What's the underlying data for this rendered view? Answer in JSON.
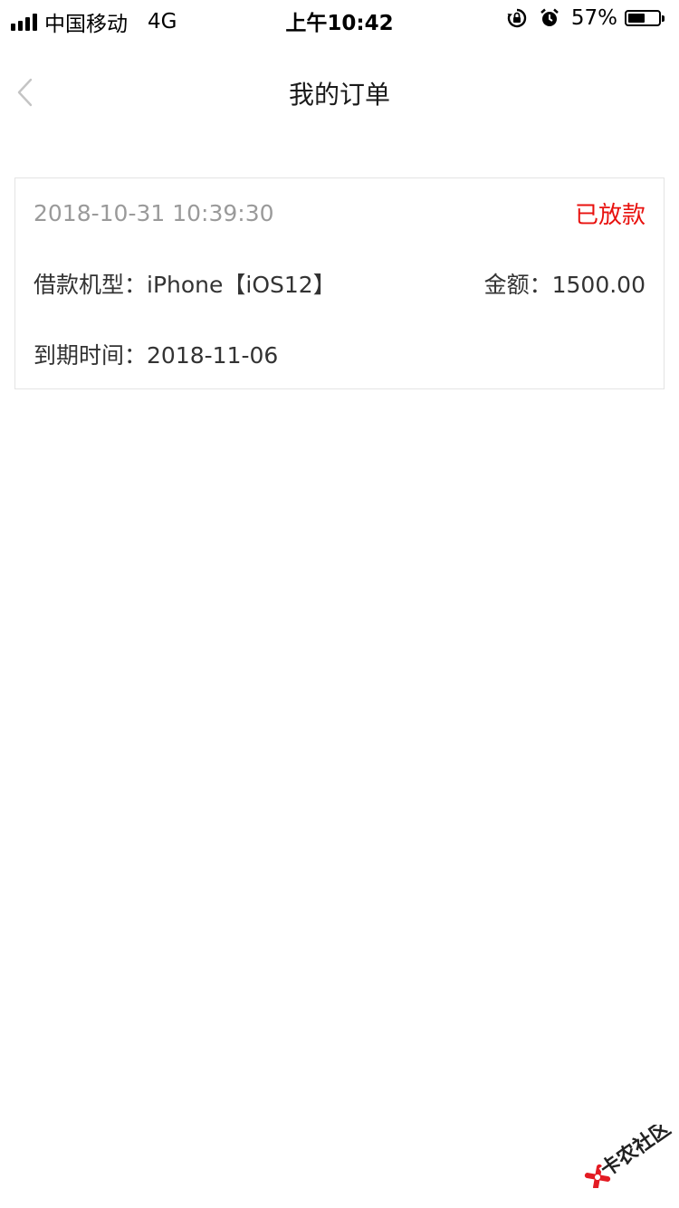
{
  "status_bar": {
    "carrier": "中国移动",
    "network": "4G",
    "time": "上午10:42",
    "battery_percent": "57%",
    "battery_level": 0.57,
    "icons": [
      "signal-icon",
      "rotation-lock-icon",
      "alarm-icon",
      "battery-icon"
    ]
  },
  "nav": {
    "title": "我的订单",
    "back_icon": "chevron-left-icon"
  },
  "order": {
    "datetime": "2018-10-31 10:39:30",
    "status": "已放款",
    "model_label": "借款机型：",
    "model_value": "iPhone【iOS12】",
    "amount_label": "金额：",
    "amount_value": "1500.00",
    "due_label": "到期时间：",
    "due_value": "2018-11-06"
  },
  "watermark": {
    "text": "卡农社区"
  },
  "colors": {
    "status_red": "#e8110e",
    "muted_gray": "#9a9a9a",
    "border": "#e4e4e4",
    "text": "#333333"
  }
}
